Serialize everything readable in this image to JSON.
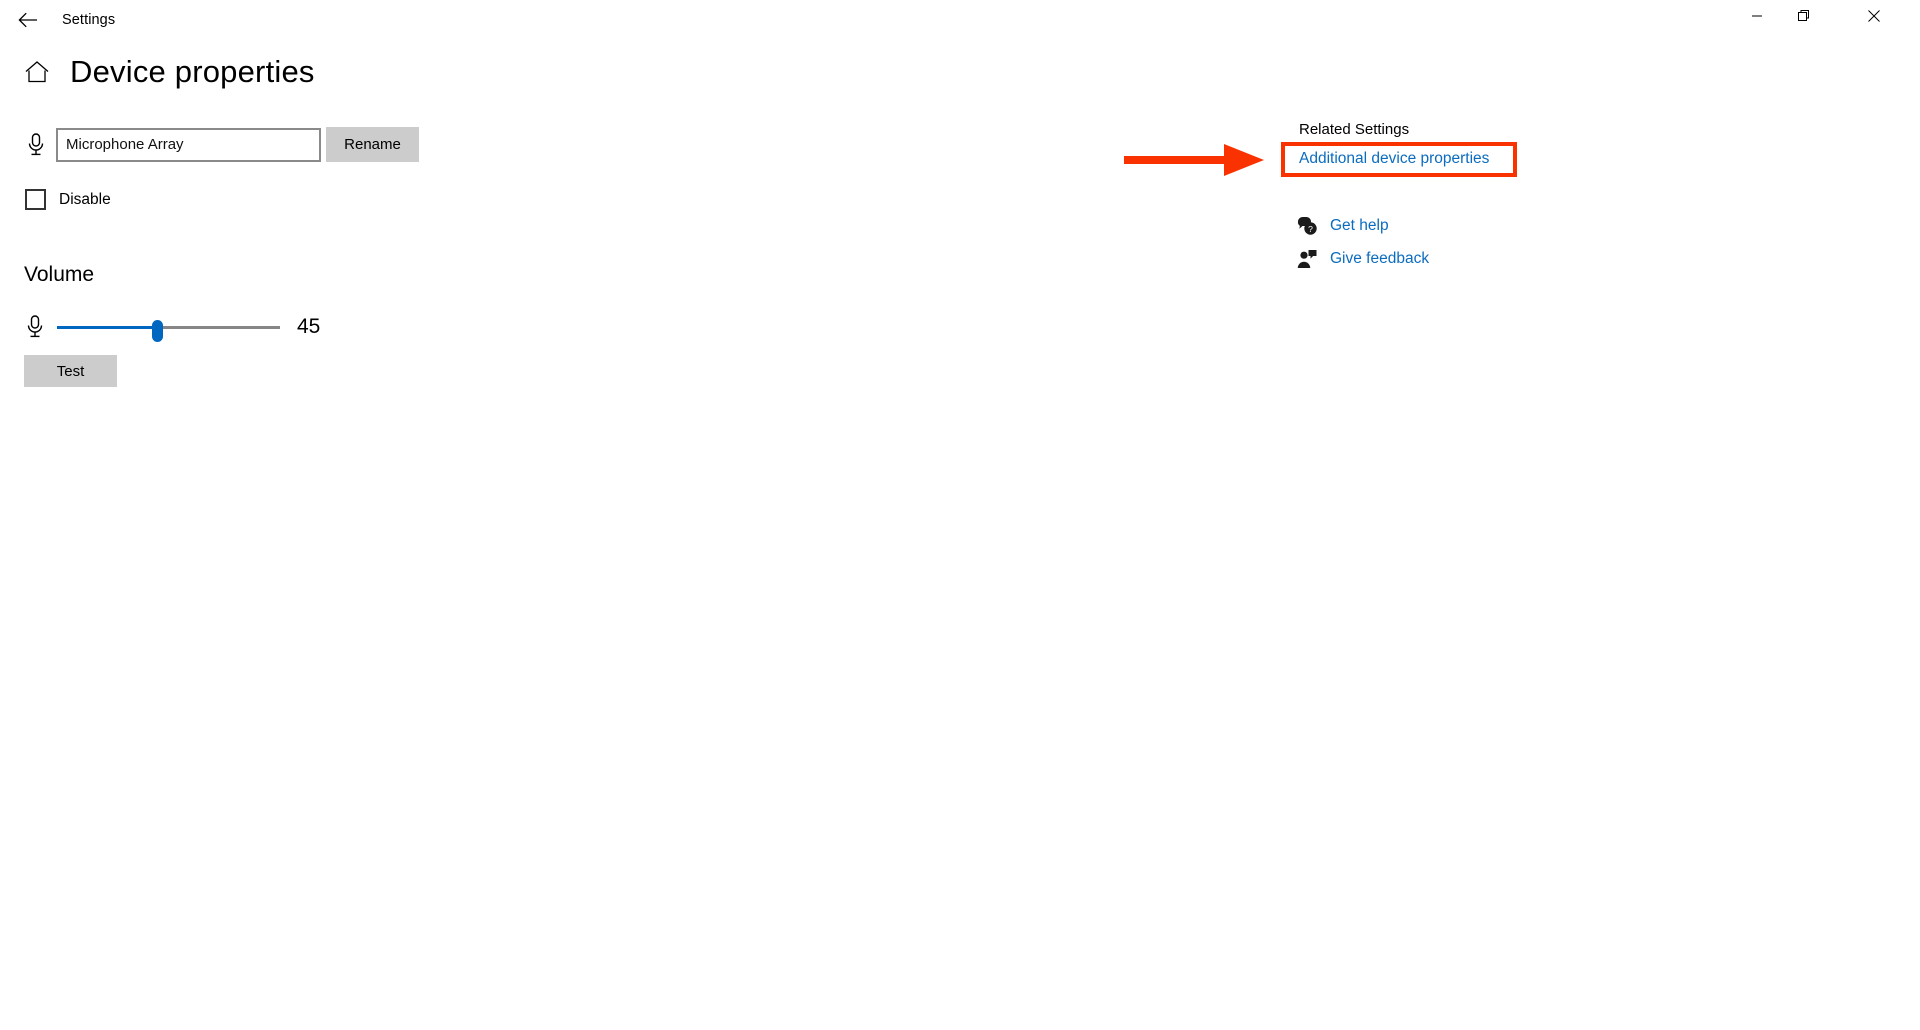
{
  "window": {
    "title": "Settings",
    "back_icon": "back-arrow-icon",
    "controls": {
      "minimize": "minimize-icon",
      "maximize": "maximize-restore-icon",
      "close": "close-icon"
    }
  },
  "page": {
    "home_icon": "home-icon",
    "title": "Device properties"
  },
  "device": {
    "icon": "microphone-icon",
    "name_value": "Microphone Array",
    "name_placeholder": "Device name",
    "rename_label": "Rename"
  },
  "disable": {
    "label": "Disable",
    "checked": false
  },
  "volume": {
    "heading": "Volume",
    "icon": "microphone-icon",
    "value": 45,
    "value_text": "45",
    "min": 0,
    "max": 100,
    "test_label": "Test"
  },
  "related": {
    "heading": "Related Settings",
    "additional_properties_label": "Additional device properties",
    "links": [
      {
        "icon": "help-bubble-icon",
        "label": "Get help"
      },
      {
        "icon": "feedback-person-icon",
        "label": "Give feedback"
      }
    ]
  },
  "annotation": {
    "arrow": "red-arrow-pointing-right",
    "highlight_box": "red-highlight-rectangle"
  },
  "colors": {
    "accent": "#0067c0",
    "link": "#0b6cbf",
    "annotation_red": "#fa3200",
    "button_face": "#cccccc",
    "input_border": "#8a8a8a",
    "track": "#868686",
    "background": "#ffffff"
  }
}
